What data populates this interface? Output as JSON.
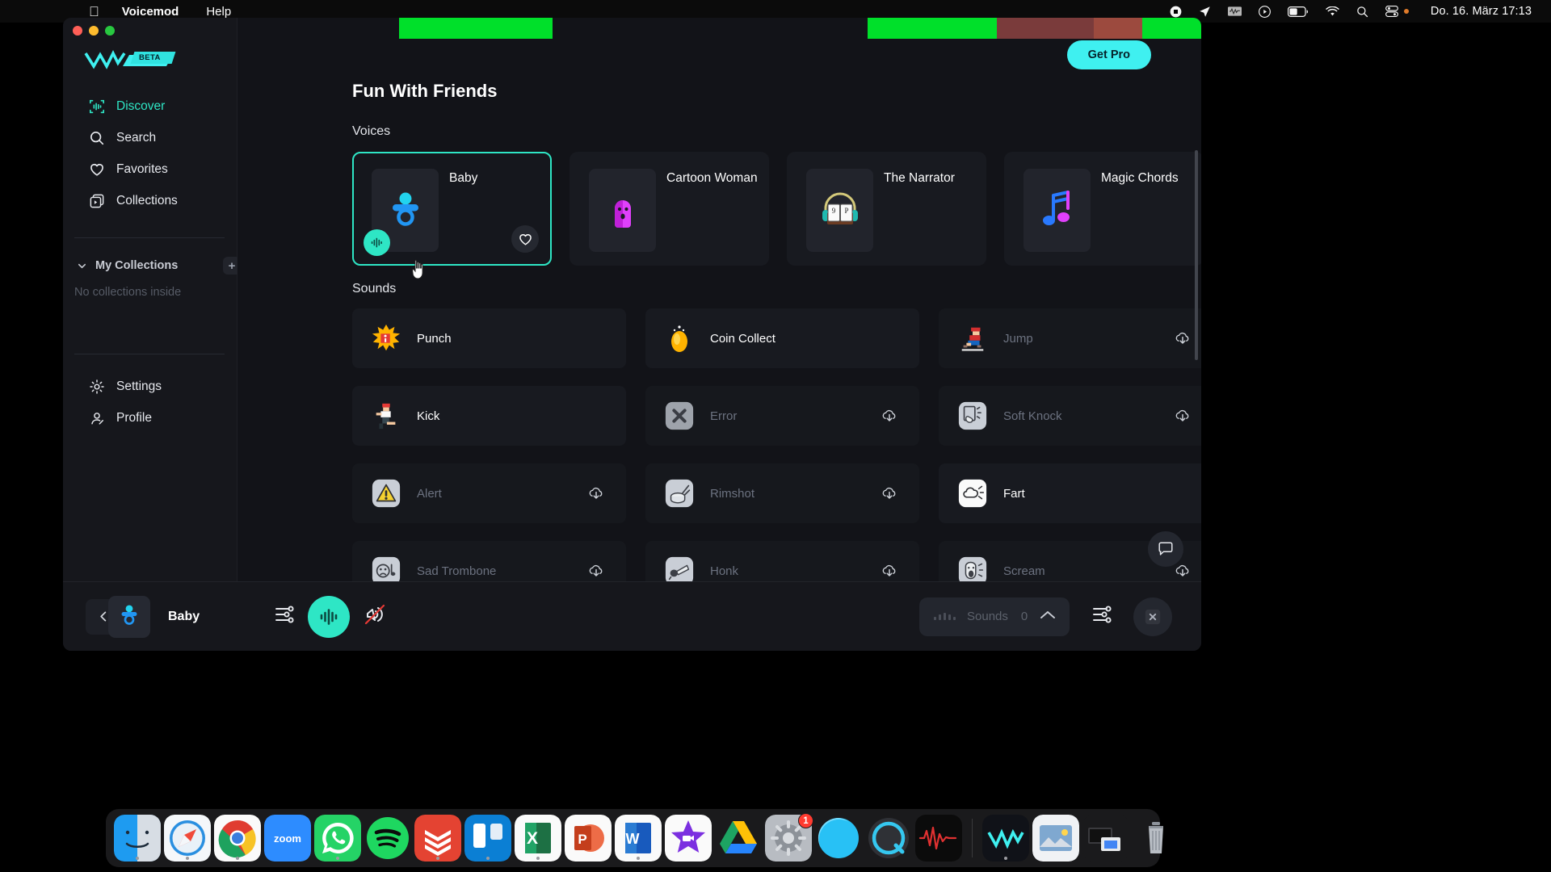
{
  "menubar": {
    "apple_icon": "apple-icon",
    "app_name": "Voicemod",
    "help": "Help",
    "status_icons": [
      "record-stop-icon",
      "location-arrow-icon",
      "audio-waveform-icon",
      "play-circle-icon",
      "battery-icon",
      "wifi-icon",
      "search-icon",
      "control-center-icon"
    ],
    "clock": "Do. 16. März  17:13"
  },
  "window": {
    "logo_text": "VM",
    "beta_label": "BETA"
  },
  "sidebar": {
    "items": [
      {
        "label": "Discover",
        "icon": "discover-waveform-icon",
        "active": true
      },
      {
        "label": "Search",
        "icon": "search-icon",
        "active": false
      },
      {
        "label": "Favorites",
        "icon": "heart-icon",
        "active": false
      },
      {
        "label": "Collections",
        "icon": "collections-icon",
        "active": false
      }
    ],
    "my_collections": {
      "label": "My Collections",
      "add_label": "+",
      "empty_text": "No collections inside"
    },
    "bottom_items": [
      {
        "label": "Settings",
        "icon": "gear-icon"
      },
      {
        "label": "Profile",
        "icon": "profile-icon"
      }
    ]
  },
  "main": {
    "get_pro_label": "Get Pro",
    "page_title": "Fun With Friends",
    "voices_label": "Voices",
    "sounds_label": "Sounds",
    "voices": [
      {
        "name": "Baby",
        "icon": "pacifier-icon",
        "selected": true,
        "favorite": false
      },
      {
        "name": "Cartoon Woman",
        "icon": "cartoon-woman-icon",
        "selected": false,
        "favorite": false
      },
      {
        "name": "The Narrator",
        "icon": "narrator-book-headphones-icon",
        "selected": false,
        "favorite": false
      },
      {
        "name": "Magic Chords",
        "icon": "music-note-icon",
        "selected": false,
        "favorite": false
      }
    ],
    "sounds": [
      {
        "name": "Punch",
        "icon": "punch-explosion-icon",
        "locked": false
      },
      {
        "name": "Coin Collect",
        "icon": "coin-icon",
        "locked": false
      },
      {
        "name": "Jump",
        "icon": "mario-jump-icon",
        "locked": true
      },
      {
        "name": "Kick",
        "icon": "kick-fighter-icon",
        "locked": false
      },
      {
        "name": "Error",
        "icon": "error-x-icon",
        "locked": true
      },
      {
        "name": "Soft Knock",
        "icon": "knock-hand-icon",
        "locked": true
      },
      {
        "name": "Alert",
        "icon": "alert-triangle-icon",
        "locked": true
      },
      {
        "name": "Rimshot",
        "icon": "drum-icon",
        "locked": true
      },
      {
        "name": "Fart",
        "icon": "fart-cloud-icon",
        "locked": false
      },
      {
        "name": "Sad Trombone",
        "icon": "sad-trombone-icon",
        "locked": true
      },
      {
        "name": "Honk",
        "icon": "horn-icon",
        "locked": true
      },
      {
        "name": "Scream",
        "icon": "scream-face-icon",
        "locked": true
      }
    ]
  },
  "bottombar": {
    "voice_name": "Baby",
    "voice_icon": "pacifier-icon",
    "prev_icon": "chevron-left-icon",
    "voicelab_icon": "sliders-icon",
    "voice_changer_icon": "waveform-icon",
    "hear_myself_icon": "hear-myself-muted-icon",
    "sounds_label": "Sounds",
    "sounds_count": "0",
    "expand_icon": "chevron-up-icon",
    "soundboard_settings_icon": "sliders-icon",
    "close_icon": "close-x-icon"
  },
  "dock": {
    "apps": [
      {
        "name": "Finder",
        "running": true
      },
      {
        "name": "Safari",
        "running": true
      },
      {
        "name": "Google Chrome",
        "running": true
      },
      {
        "name": "zoom",
        "running": false
      },
      {
        "name": "WhatsApp",
        "running": true
      },
      {
        "name": "Spotify",
        "running": false
      },
      {
        "name": "Todoist",
        "running": true
      },
      {
        "name": "Trello",
        "running": true
      },
      {
        "name": "Microsoft Excel",
        "running": true
      },
      {
        "name": "Microsoft PowerPoint",
        "running": false
      },
      {
        "name": "Microsoft Word",
        "running": true
      },
      {
        "name": "iMovie",
        "running": false
      },
      {
        "name": "Google Drive",
        "running": false
      },
      {
        "name": "System Settings",
        "running": false,
        "badge": "1"
      },
      {
        "name": "Sphere",
        "running": false
      },
      {
        "name": "QuickTime Player",
        "running": false
      },
      {
        "name": "Audio App",
        "running": false
      },
      {
        "name": "Voicemod",
        "running": true
      },
      {
        "name": "Preview",
        "running": false
      },
      {
        "name": "Screens",
        "running": false
      },
      {
        "name": "Trash",
        "running": false
      }
    ]
  },
  "colors": {
    "accent_cyan": "#2ee6c5",
    "get_pro": "#3ff0f0",
    "window_bg": "#121318",
    "sidebar_bg": "#16171c",
    "card_bg": "#181a20"
  }
}
